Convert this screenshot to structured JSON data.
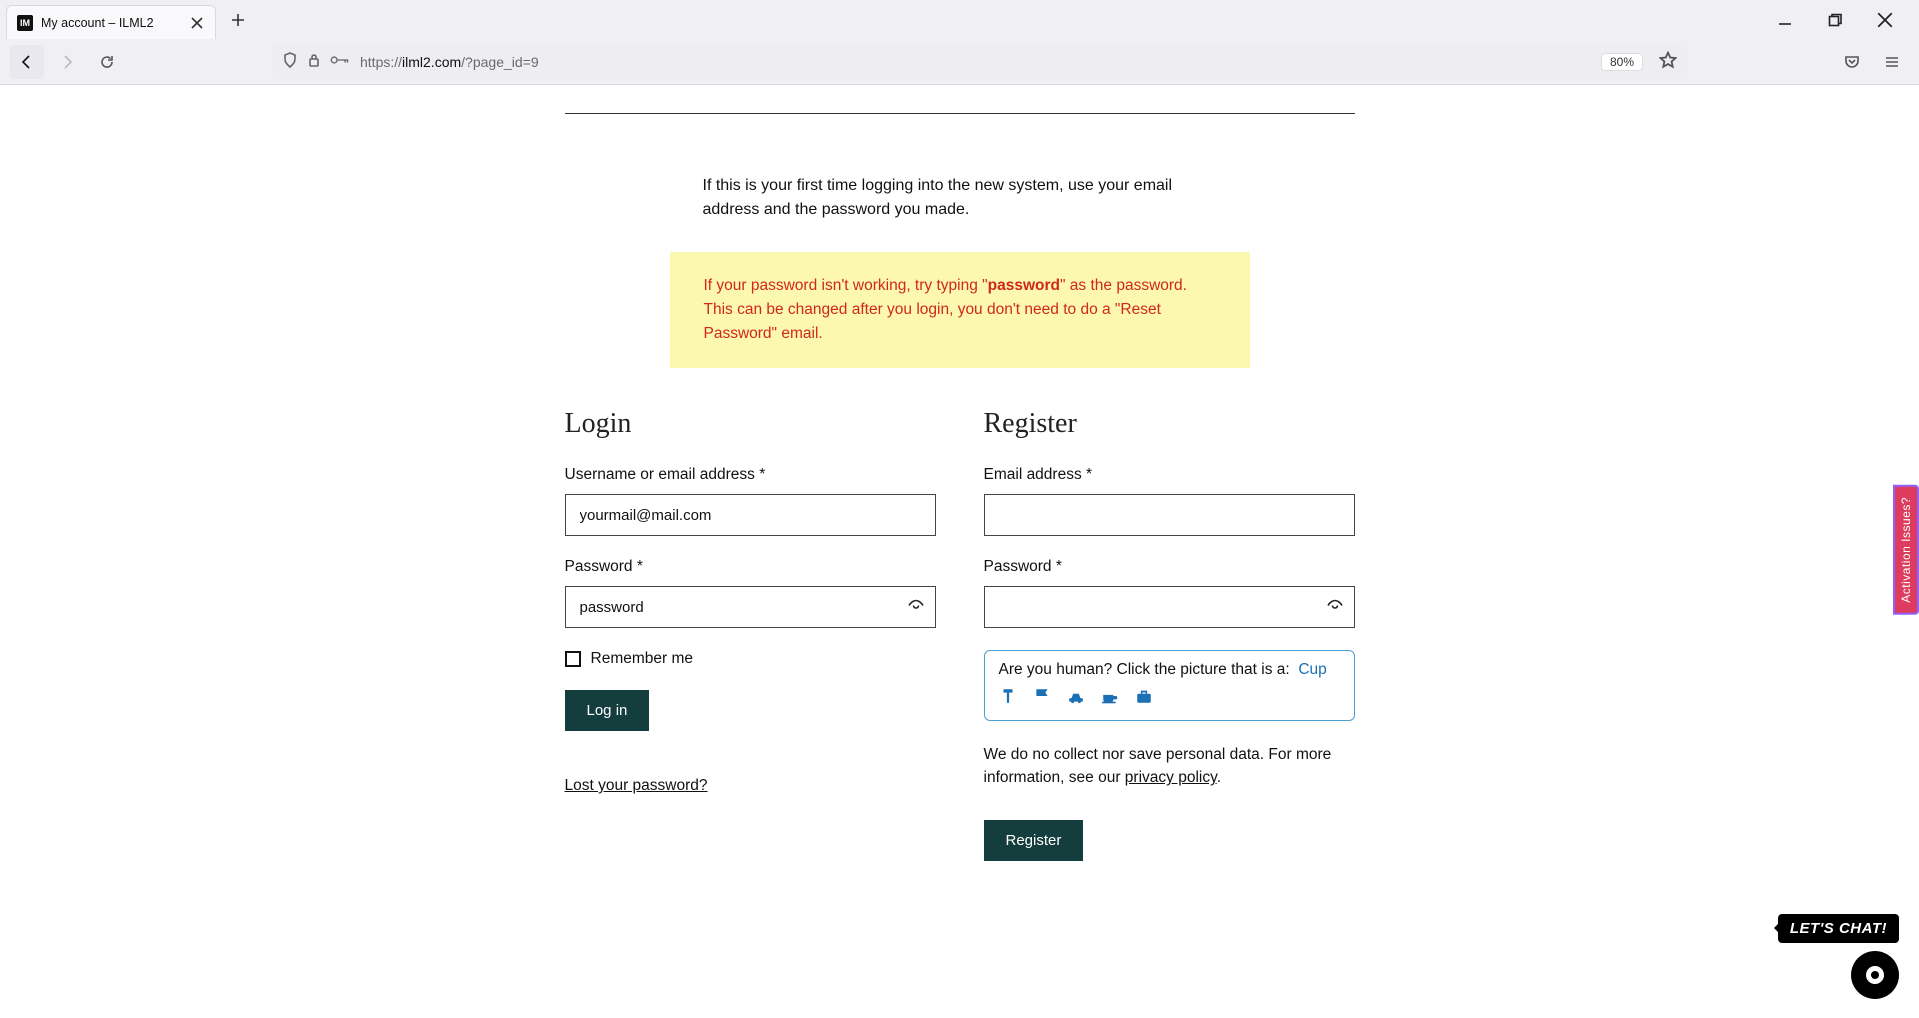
{
  "browser": {
    "tab_title": "My account – ILML2",
    "favicon_text": "IM",
    "url_display_prefix": "https://",
    "url_display_domain": "ilml2.com",
    "url_display_path": "/?page_id=9",
    "zoom": "80%"
  },
  "page": {
    "intro": "If this is your first time logging into the new system, use your email address and the password you made.",
    "notice_pre": "If your password isn't working, try typing \"",
    "notice_bold": "password",
    "notice_post": "\" as the password. This can be changed after you login, you don't need to do a \"Reset Password\" email."
  },
  "login": {
    "heading": "Login",
    "username_label": "Username or email address *",
    "username_value": "yourmail@mail.com",
    "password_label": "Password *",
    "password_value": "password",
    "remember_label": "Remember me",
    "submit_label": "Log in",
    "lost_label": "Lost your password?"
  },
  "register": {
    "heading": "Register",
    "email_label": "Email address *",
    "email_value": "",
    "password_label": "Password *",
    "password_value": "",
    "captcha_prompt": "Are you human? Click the picture that is a:",
    "captcha_answer": "Cup",
    "privacy_pre": "We do no collect nor save personal data. For more information, see our ",
    "privacy_link": "privacy policy",
    "privacy_post": ".",
    "submit_label": "Register"
  },
  "side_tab": "Activation Issues?",
  "chat_label": "LET'S CHAT!"
}
